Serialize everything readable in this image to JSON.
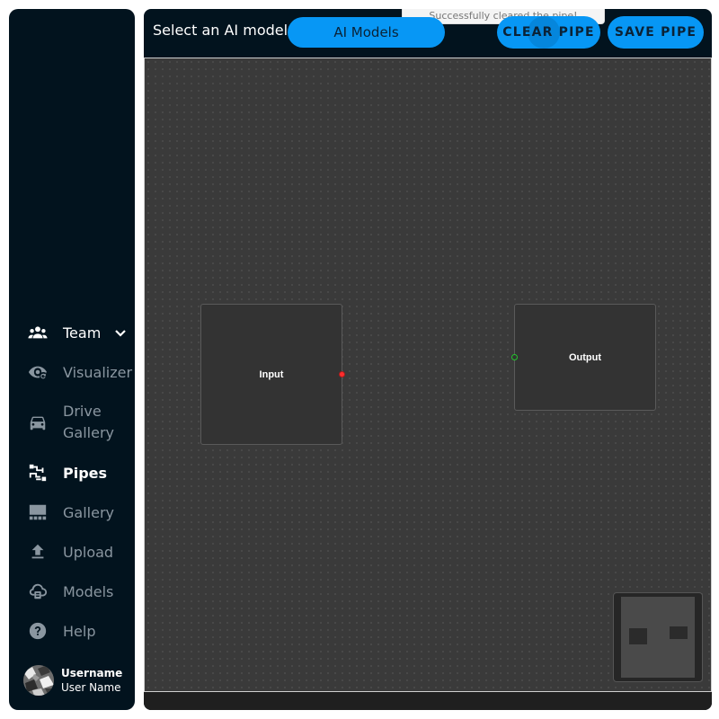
{
  "sidebar": {
    "items": [
      {
        "label": "Team",
        "icon": "team-icon"
      },
      {
        "label": "Visualizer",
        "icon": "eye-icon"
      },
      {
        "label": "Drive Gallery",
        "icon": "car-icon"
      },
      {
        "label": "Pipes",
        "icon": "pipes-icon",
        "active": true
      },
      {
        "label": "Gallery",
        "icon": "gallery-icon"
      },
      {
        "label": "Upload",
        "icon": "upload-icon"
      },
      {
        "label": "Models",
        "icon": "models-icon"
      },
      {
        "label": "Help",
        "icon": "help-icon"
      }
    ],
    "drive_line1": "Drive",
    "drive_line2": "Gallery",
    "user": {
      "username": "Username",
      "name": "User Name"
    }
  },
  "toolbar": {
    "select_label": "Select an AI model",
    "models_button": "AI Models",
    "clear_button": "CLEAR PIPE",
    "save_button": "SAVE PIPE"
  },
  "toast": {
    "message": "Successfully cleared the pipe!"
  },
  "canvas": {
    "nodes": [
      {
        "label": "Input",
        "handle_color": "#ff2d2d"
      },
      {
        "label": "Output",
        "handle_color": "#22c62c"
      }
    ]
  },
  "colors": {
    "panel": "#02131e",
    "accent": "#0797f5",
    "canvas": "#3a3a3a"
  }
}
